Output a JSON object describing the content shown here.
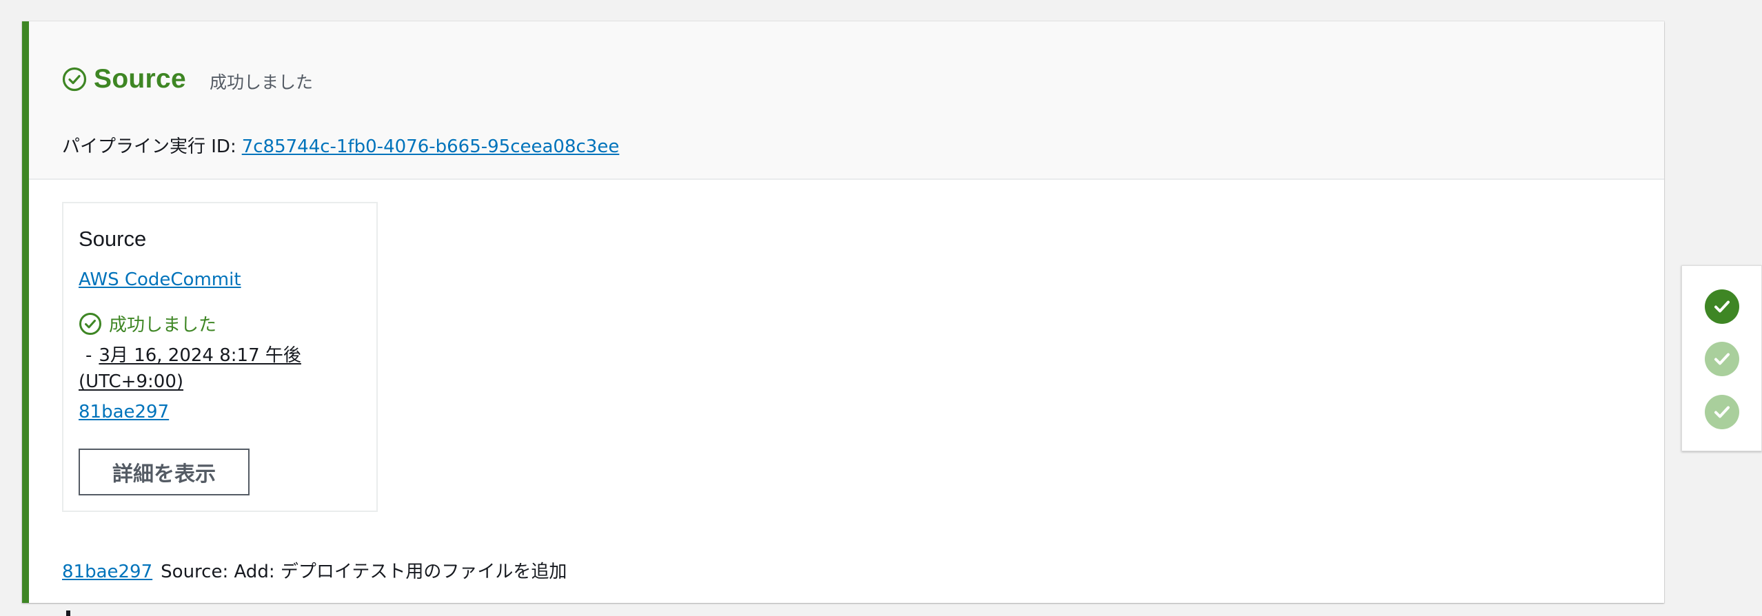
{
  "stage": {
    "title": "Source",
    "status": "成功しました",
    "execution_label": "パイプライン実行 ID:",
    "execution_id": "7c85744c-1fb0-4076-b665-95ceea08c3ee"
  },
  "action": {
    "title": "Source",
    "provider": "AWS CodeCommit",
    "status": "成功しました",
    "dash": "-",
    "timestamp_line1": "3月 16, 2024 8:17 午後",
    "timestamp_line2": "(UTC+9:00)",
    "commit_id": "81bae297",
    "details_button": "詳細を表示"
  },
  "commit": {
    "id": "81bae297",
    "message": "Source: Add: デプロイテスト用のファイルを追加"
  },
  "minimap": {
    "items": [
      {
        "state": "active",
        "icon": "check-icon"
      },
      {
        "state": "inactive",
        "icon": "check-icon"
      },
      {
        "state": "inactive",
        "icon": "check-icon"
      }
    ]
  },
  "colors": {
    "success": "#3e8624",
    "link": "#0073bb",
    "success_light": "#a9cf9c",
    "text": "#16191f",
    "muted": "#545b64"
  }
}
